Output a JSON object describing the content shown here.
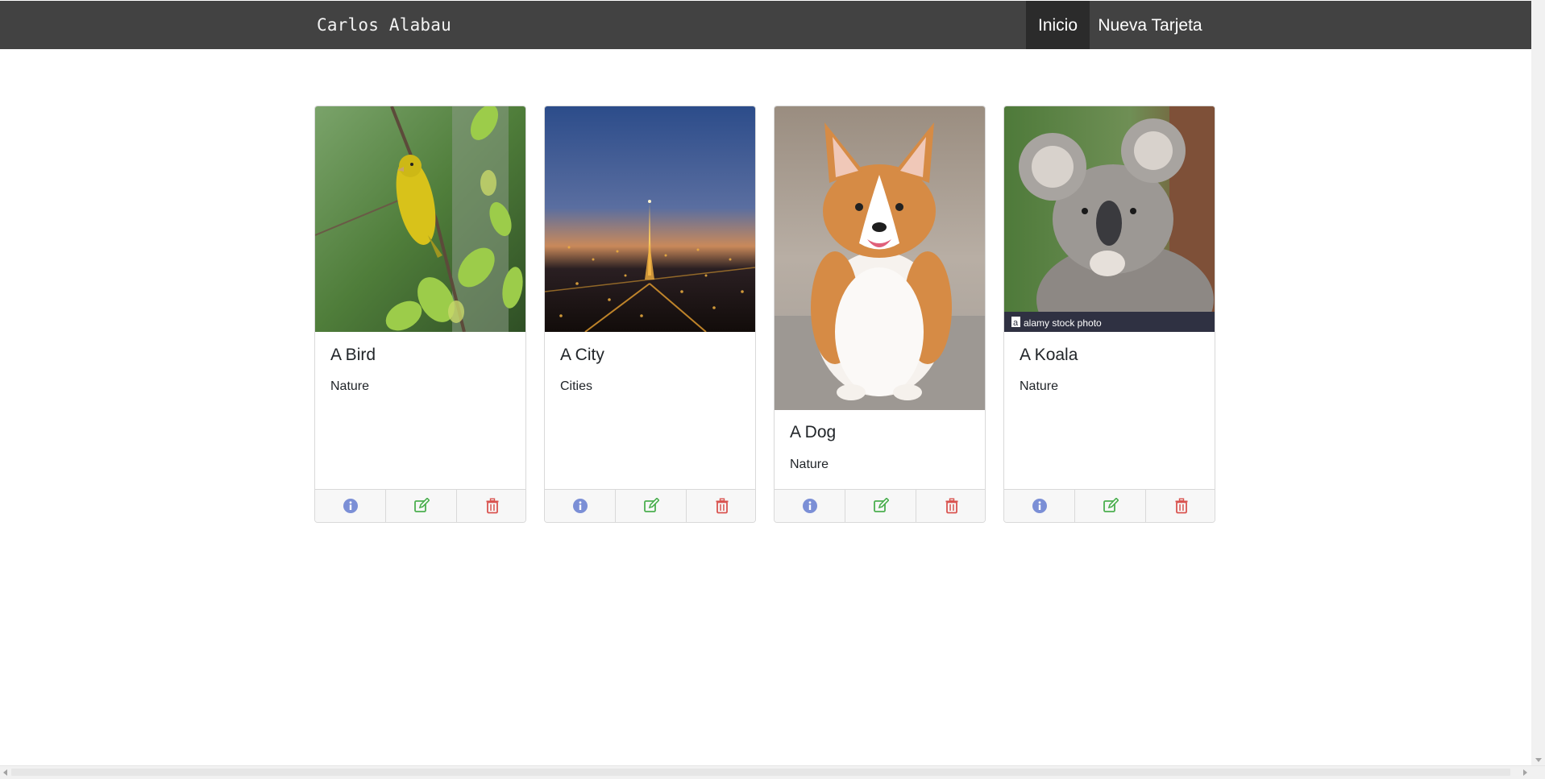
{
  "navbar": {
    "brand": "Carlos Alabau",
    "items": [
      {
        "label": "Inicio",
        "active": true
      },
      {
        "label": "Nueva Tarjeta",
        "active": false
      }
    ],
    "bg_color": "#424242",
    "active_bg_color": "#2b2b2b"
  },
  "cards": [
    {
      "title": "A Bird",
      "category": "Nature",
      "image": "yellow-bird-photo"
    },
    {
      "title": "A City",
      "category": "Cities",
      "image": "paris-night-photo"
    },
    {
      "title": "A Dog",
      "category": "Nature",
      "image": "corgi-photo"
    },
    {
      "title": "A Koala",
      "category": "Nature",
      "image": "koala-photo"
    }
  ],
  "card_actions": {
    "info_icon": "info-circle-icon",
    "edit_icon": "edit-icon",
    "delete_icon": "trash-icon",
    "info_color": "#7b8fd6",
    "edit_color": "#4caf50",
    "delete_color": "#d9534f"
  },
  "watermarks": {
    "koala": "alamy stock photo"
  }
}
